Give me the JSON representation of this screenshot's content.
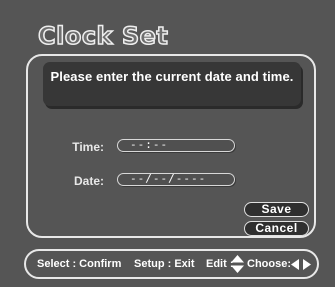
{
  "screen": {
    "title": "Clock Set",
    "message": "Please enter the current date and time."
  },
  "form": {
    "time_label": "Time:",
    "time_value": "--:--",
    "date_label": "Date:",
    "date_value": "--/--/----"
  },
  "buttons": {
    "save": "Save",
    "cancel": "Cancel"
  },
  "footer": {
    "select_hint": "Select : Confirm",
    "setup_hint": "Setup : Exit",
    "edit_hint": "Edit :",
    "edit_icon": "up-down-triangle-icon",
    "choose_hint": "Choose:",
    "choose_icon": "left-right-triangle-icon"
  },
  "colors": {
    "background": "#555555",
    "panel_border": "#e8e8e8",
    "message_bg": "#373737",
    "button_bg": "#2f2f2f"
  }
}
